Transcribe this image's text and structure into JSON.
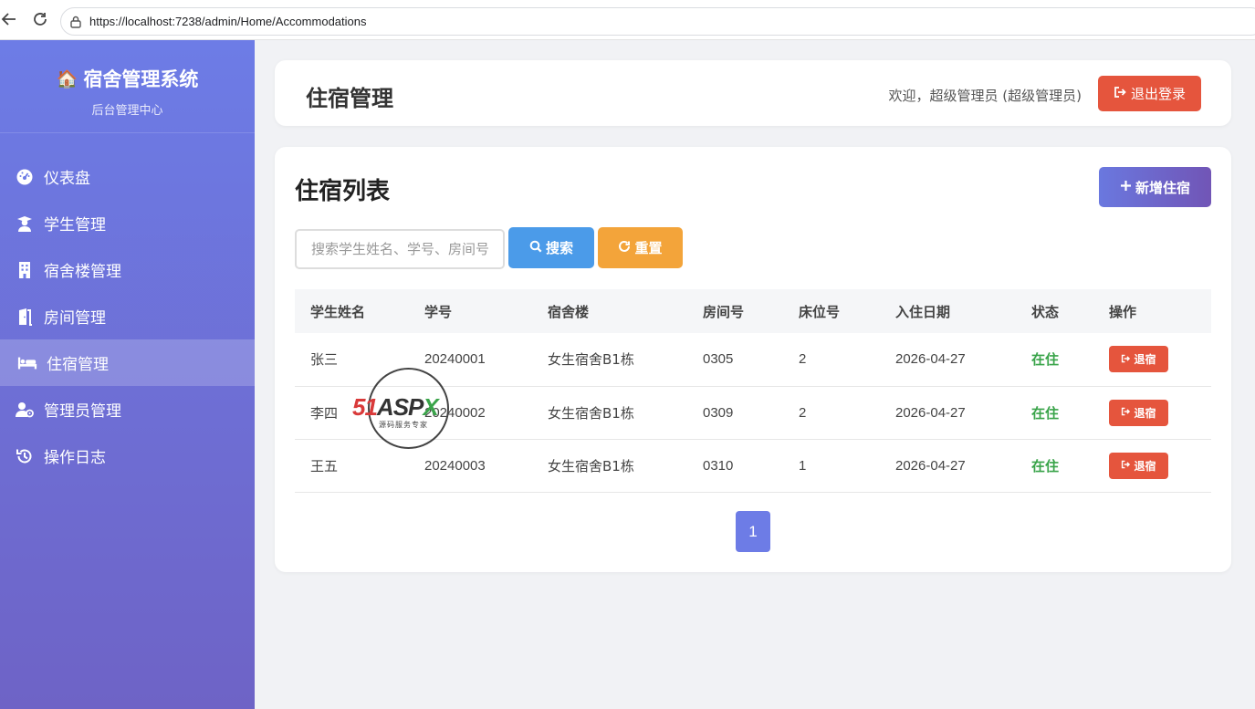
{
  "browser": {
    "url": "https://localhost:7238/admin/Home/Accommodations"
  },
  "sidebar": {
    "brand_emoji": "🏠",
    "brand_title": "宿舍管理系统",
    "brand_subtitle": "后台管理中心",
    "items": [
      {
        "label": "仪表盘",
        "icon": "dashboard-icon"
      },
      {
        "label": "学生管理",
        "icon": "student-icon"
      },
      {
        "label": "宿舍楼管理",
        "icon": "building-icon"
      },
      {
        "label": "房间管理",
        "icon": "door-icon"
      },
      {
        "label": "住宿管理",
        "icon": "bed-icon",
        "active": true
      },
      {
        "label": "管理员管理",
        "icon": "admin-user-icon"
      },
      {
        "label": "操作日志",
        "icon": "history-icon"
      }
    ]
  },
  "header": {
    "title": "住宿管理",
    "welcome": "欢迎，超级管理员 (超级管理员)",
    "logout_label": "退出登录"
  },
  "list": {
    "title": "住宿列表",
    "add_label": "新增住宿",
    "search_placeholder": "搜索学生姓名、学号、房间号",
    "search_label": "搜索",
    "reset_label": "重置",
    "columns": [
      "学生姓名",
      "学号",
      "宿舍楼",
      "房间号",
      "床位号",
      "入住日期",
      "状态",
      "操作"
    ],
    "rows": [
      {
        "name": "张三",
        "student_no": "20240001",
        "building": "女生宿舍B1栋",
        "room": "0305",
        "bed": "2",
        "date": "2026-04-27",
        "status": "在住",
        "action": "退宿"
      },
      {
        "name": "李四",
        "student_no": "20240002",
        "building": "女生宿舍B1栋",
        "room": "0309",
        "bed": "2",
        "date": "2026-04-27",
        "status": "在住",
        "action": "退宿"
      },
      {
        "name": "王五",
        "student_no": "20240003",
        "building": "女生宿舍B1栋",
        "room": "0310",
        "bed": "1",
        "date": "2026-04-27",
        "status": "在住",
        "action": "退宿"
      }
    ],
    "page": "1"
  },
  "watermark": {
    "logo_red": "51",
    "logo_dark": "ASP",
    "logo_green": "X",
    "tagline": "源码服务专家"
  },
  "colors": {
    "sidebar_top": "#6d7ce6",
    "sidebar_bottom": "#6e63c6",
    "danger": "#e5553d",
    "primary": "#4b9be9",
    "warning": "#f3a43a",
    "success": "#3aa44a"
  }
}
